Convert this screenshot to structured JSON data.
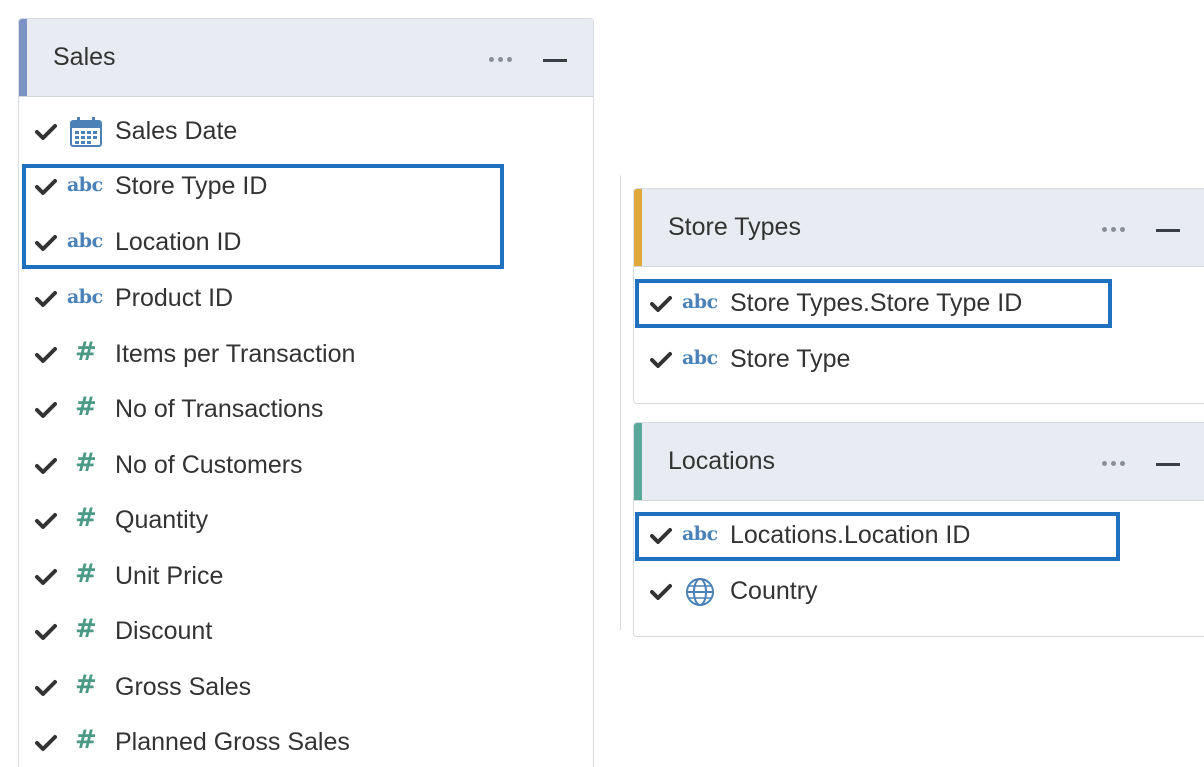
{
  "colors": {
    "highlight": "#1f70c1",
    "sales_accent": "#7b93c4",
    "store_types_accent": "#e0a83a",
    "locations_accent": "#5aa89a",
    "text_icon": "#4a82b8",
    "number_icon": "#4a9a86"
  },
  "panels": [
    {
      "title": "Sales",
      "fields": [
        {
          "label": "Sales Date",
          "type_icon": "calendar-icon"
        },
        {
          "label": "Store Type ID",
          "type_icon": "abc"
        },
        {
          "label": "Location ID",
          "type_icon": "abc"
        },
        {
          "label": "Product ID",
          "type_icon": "abc"
        },
        {
          "label": "Items per Transaction",
          "type_icon": "#"
        },
        {
          "label": "No of Transactions",
          "type_icon": "#"
        },
        {
          "label": "No of Customers",
          "type_icon": "#"
        },
        {
          "label": "Quantity",
          "type_icon": "#"
        },
        {
          "label": "Unit Price",
          "type_icon": "#"
        },
        {
          "label": "Discount",
          "type_icon": "#"
        },
        {
          "label": "Gross Sales",
          "type_icon": "#"
        },
        {
          "label": "Planned Gross Sales",
          "type_icon": "#"
        }
      ]
    },
    {
      "title": "Store Types",
      "fields": [
        {
          "label": "Store Types.Store Type ID",
          "type_icon": "abc"
        },
        {
          "label": "Store Type",
          "type_icon": "abc"
        }
      ]
    },
    {
      "title": "Locations",
      "fields": [
        {
          "label": "Locations.Location ID",
          "type_icon": "abc"
        },
        {
          "label": "Country",
          "type_icon": "globe-icon"
        }
      ]
    }
  ]
}
